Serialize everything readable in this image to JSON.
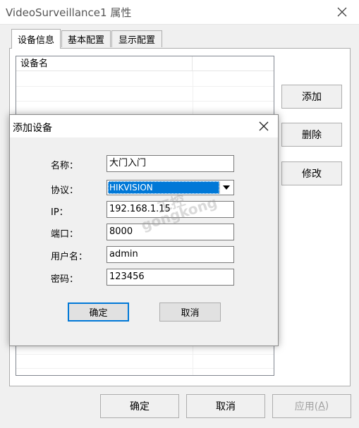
{
  "window": {
    "title": "VideoSurveillance1 属性"
  },
  "tabs": [
    {
      "label": "设备信息"
    },
    {
      "label": "基本配置"
    },
    {
      "label": "显示配置"
    }
  ],
  "device_list": {
    "column_headers": [
      "设备名",
      ""
    ]
  },
  "side_buttons": {
    "add": "添加",
    "delete": "删除",
    "modify": "修改"
  },
  "footer": {
    "ok": "确定",
    "cancel": "取消",
    "apply": "应用(",
    "apply_key": "A",
    "apply_close": ")"
  },
  "dialog": {
    "title": "添加设备",
    "fields": [
      {
        "label": "名称：",
        "value": "大门入门"
      },
      {
        "label": "协议：",
        "value": "HIKVISION"
      },
      {
        "label": "IP：",
        "value": "192.168.1.15"
      },
      {
        "label": "端口：",
        "value": "8000"
      },
      {
        "label": "用户名：",
        "value": "admin"
      },
      {
        "label": "密码：",
        "value": "123456"
      }
    ],
    "ok": "确定",
    "cancel": "取消"
  },
  "watermark": {
    "line1": "工控",
    "line2": "gongkong"
  },
  "colors": {
    "selection": "#0078d7",
    "dialog_bg": "#f0f0f0",
    "border": "#adadad"
  }
}
